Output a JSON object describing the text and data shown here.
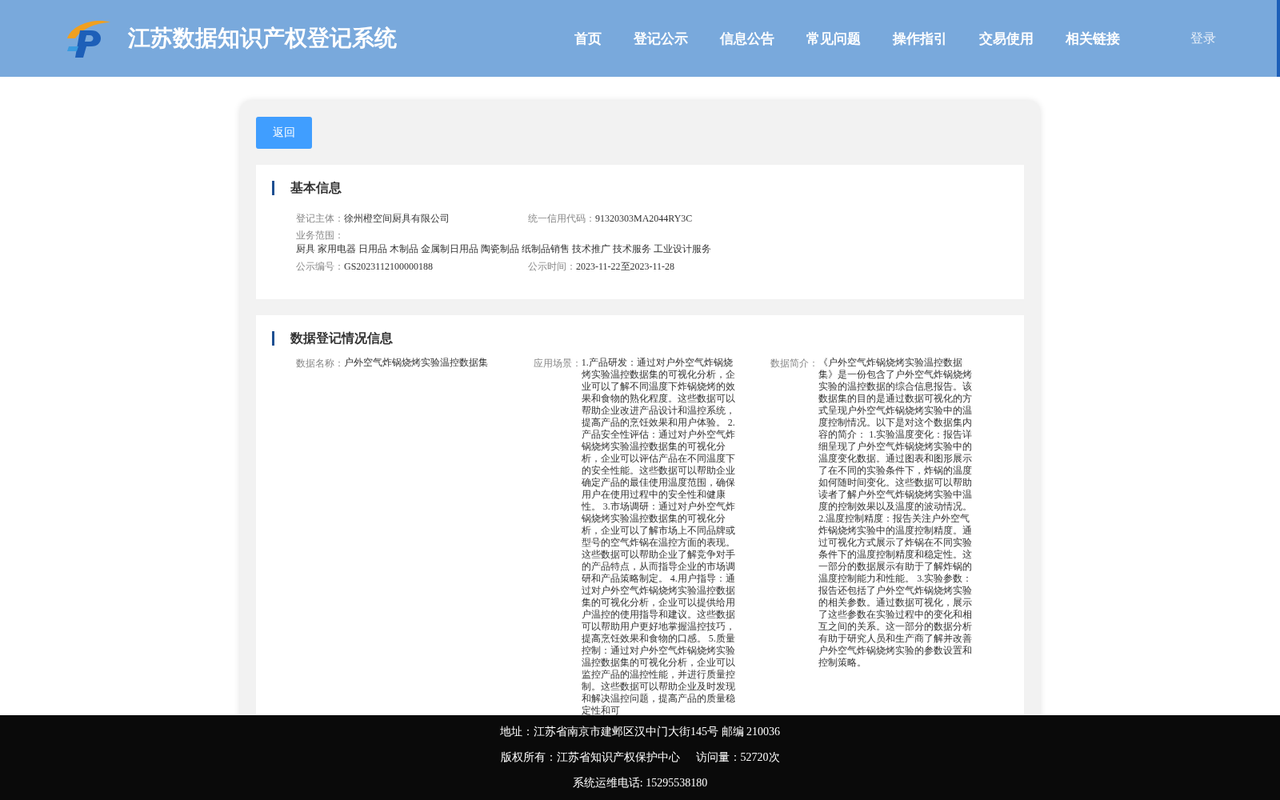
{
  "header": {
    "title": "江苏数据知识产权登记系统",
    "nav": [
      "首页",
      "登记公示",
      "信息公告",
      "常见问题",
      "操作指引",
      "交易使用",
      "相关链接"
    ],
    "login": "登录"
  },
  "back_button": "返回",
  "basic_info": {
    "heading": "基本信息",
    "rows": [
      [
        {
          "label": "登记主体：",
          "value": "徐州橙空间厨具有限公司"
        },
        {
          "label": "统一信用代码：",
          "value": "91320303MA2044RY3C"
        }
      ],
      [
        {
          "label": "业务范围：",
          "value": "厨具 家用电器 日用品 木制品 金属制日用品 陶瓷制品 纸制品销售 技术推广 技术服务 工业设计服务"
        }
      ],
      [
        {
          "label": "公示编号：",
          "value": "GS2023112100000188"
        },
        {
          "label": "公示时间：",
          "value": "2023-11-22至2023-11-28"
        }
      ]
    ]
  },
  "data_info": {
    "heading": "数据登记情况信息",
    "fields": [
      {
        "label": "数据名称：",
        "value": "户外空气炸锅烧烤实验温控数据集"
      },
      {
        "label": "应用场景：",
        "value": "1.产品研发：通过对户外空气炸锅烧烤实验温控数据集的可视化分析，企业可以了解不同温度下炸锅烧烤的效果和食物的熟化程度。这些数据可以帮助企业改进产品设计和温控系统，提高产品的烹饪效果和用户体验。 2.产品安全性评估：通过对户外空气炸锅烧烤实验温控数据集的可视化分析，企业可以评估产品在不同温度下的安全性能。这些数据可以帮助企业确定产品的最佳使用温度范围，确保用户在使用过程中的安全性和健康性。 3.市场调研：通过对户外空气炸锅烧烤实验温控数据集的可视化分析，企业可以了解市场上不同品牌或型号的空气炸锅在温控方面的表现。这些数据可以帮助企业了解竞争对手的产品特点，从而指导企业的市场调研和产品策略制定。 4.用户指导：通过对户外空气炸锅烧烤实验温控数据集的可视化分析，企业可以提供给用户温控的使用指导和建议。这些数据可以帮助用户更好地掌握温控技巧，提高烹饪效果和食物的口感。 5.质量控制：通过对户外空气炸锅烧烤实验温控数据集的可视化分析，企业可以监控产品的温控性能，并进行质量控制。这些数据可以帮助企业及时发现和解决温控问题，提高产品的质量稳定性和可"
      },
      {
        "label": "数据简介：",
        "value": "《户外空气炸锅烧烤实验温控数据集》是一份包含了户外空气炸锅烧烤实验的温控数据的综合信息报告。该数据集的目的是通过数据可视化的方式呈现户外空气炸锅烧烤实验中的温度控制情况。以下是对这个数据集内容的简介： 1.实验温度变化：报告详细呈现了户外空气炸锅烧烤实验中的温度变化数据。通过图表和图形展示了在不同的实验条件下，炸锅的温度如何随时间变化。这些数据可以帮助读者了解户外空气炸锅烧烤实验中温度的控制效果以及温度的波动情况。 2.温度控制精度：报告关注户外空气炸锅烧烤实验中的温度控制精度。通过可视化方式展示了炸锅在不同实验条件下的温度控制精度和稳定性。这一部分的数据展示有助于了解炸锅的温度控制能力和性能。 3.实验参数：报告还包括了户外空气炸锅烧烤实验的相关参数。通过数据可视化，展示了这些参数在实验过程中的变化和相互之间的关系。这一部分的数据分析有助于研究人员和生产商了解并改善户外空气炸锅烧烤实验的参数设置和控制策略。"
      }
    ]
  },
  "footer": {
    "address": "地址：江苏省南京市建邺区汉中门大街145号 邮编 210036",
    "copyright": "版权所有：江苏省知识产权保护中心",
    "visits": "访问量：52720次",
    "phone": "系统运维电话: 15295538180"
  }
}
